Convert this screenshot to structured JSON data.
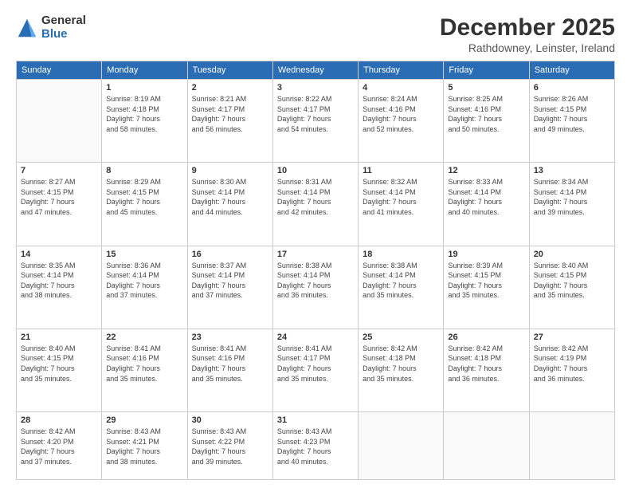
{
  "logo": {
    "general": "General",
    "blue": "Blue"
  },
  "title": "December 2025",
  "location": "Rathdowney, Leinster, Ireland",
  "days_of_week": [
    "Sunday",
    "Monday",
    "Tuesday",
    "Wednesday",
    "Thursday",
    "Friday",
    "Saturday"
  ],
  "weeks": [
    [
      {
        "day": "",
        "info": ""
      },
      {
        "day": "1",
        "info": "Sunrise: 8:19 AM\nSunset: 4:18 PM\nDaylight: 7 hours\nand 58 minutes."
      },
      {
        "day": "2",
        "info": "Sunrise: 8:21 AM\nSunset: 4:17 PM\nDaylight: 7 hours\nand 56 minutes."
      },
      {
        "day": "3",
        "info": "Sunrise: 8:22 AM\nSunset: 4:17 PM\nDaylight: 7 hours\nand 54 minutes."
      },
      {
        "day": "4",
        "info": "Sunrise: 8:24 AM\nSunset: 4:16 PM\nDaylight: 7 hours\nand 52 minutes."
      },
      {
        "day": "5",
        "info": "Sunrise: 8:25 AM\nSunset: 4:16 PM\nDaylight: 7 hours\nand 50 minutes."
      },
      {
        "day": "6",
        "info": "Sunrise: 8:26 AM\nSunset: 4:15 PM\nDaylight: 7 hours\nand 49 minutes."
      }
    ],
    [
      {
        "day": "7",
        "info": "Sunrise: 8:27 AM\nSunset: 4:15 PM\nDaylight: 7 hours\nand 47 minutes."
      },
      {
        "day": "8",
        "info": "Sunrise: 8:29 AM\nSunset: 4:15 PM\nDaylight: 7 hours\nand 45 minutes."
      },
      {
        "day": "9",
        "info": "Sunrise: 8:30 AM\nSunset: 4:14 PM\nDaylight: 7 hours\nand 44 minutes."
      },
      {
        "day": "10",
        "info": "Sunrise: 8:31 AM\nSunset: 4:14 PM\nDaylight: 7 hours\nand 42 minutes."
      },
      {
        "day": "11",
        "info": "Sunrise: 8:32 AM\nSunset: 4:14 PM\nDaylight: 7 hours\nand 41 minutes."
      },
      {
        "day": "12",
        "info": "Sunrise: 8:33 AM\nSunset: 4:14 PM\nDaylight: 7 hours\nand 40 minutes."
      },
      {
        "day": "13",
        "info": "Sunrise: 8:34 AM\nSunset: 4:14 PM\nDaylight: 7 hours\nand 39 minutes."
      }
    ],
    [
      {
        "day": "14",
        "info": "Sunrise: 8:35 AM\nSunset: 4:14 PM\nDaylight: 7 hours\nand 38 minutes."
      },
      {
        "day": "15",
        "info": "Sunrise: 8:36 AM\nSunset: 4:14 PM\nDaylight: 7 hours\nand 37 minutes."
      },
      {
        "day": "16",
        "info": "Sunrise: 8:37 AM\nSunset: 4:14 PM\nDaylight: 7 hours\nand 37 minutes."
      },
      {
        "day": "17",
        "info": "Sunrise: 8:38 AM\nSunset: 4:14 PM\nDaylight: 7 hours\nand 36 minutes."
      },
      {
        "day": "18",
        "info": "Sunrise: 8:38 AM\nSunset: 4:14 PM\nDaylight: 7 hours\nand 35 minutes."
      },
      {
        "day": "19",
        "info": "Sunrise: 8:39 AM\nSunset: 4:15 PM\nDaylight: 7 hours\nand 35 minutes."
      },
      {
        "day": "20",
        "info": "Sunrise: 8:40 AM\nSunset: 4:15 PM\nDaylight: 7 hours\nand 35 minutes."
      }
    ],
    [
      {
        "day": "21",
        "info": "Sunrise: 8:40 AM\nSunset: 4:15 PM\nDaylight: 7 hours\nand 35 minutes."
      },
      {
        "day": "22",
        "info": "Sunrise: 8:41 AM\nSunset: 4:16 PM\nDaylight: 7 hours\nand 35 minutes."
      },
      {
        "day": "23",
        "info": "Sunrise: 8:41 AM\nSunset: 4:16 PM\nDaylight: 7 hours\nand 35 minutes."
      },
      {
        "day": "24",
        "info": "Sunrise: 8:41 AM\nSunset: 4:17 PM\nDaylight: 7 hours\nand 35 minutes."
      },
      {
        "day": "25",
        "info": "Sunrise: 8:42 AM\nSunset: 4:18 PM\nDaylight: 7 hours\nand 35 minutes."
      },
      {
        "day": "26",
        "info": "Sunrise: 8:42 AM\nSunset: 4:18 PM\nDaylight: 7 hours\nand 36 minutes."
      },
      {
        "day": "27",
        "info": "Sunrise: 8:42 AM\nSunset: 4:19 PM\nDaylight: 7 hours\nand 36 minutes."
      }
    ],
    [
      {
        "day": "28",
        "info": "Sunrise: 8:42 AM\nSunset: 4:20 PM\nDaylight: 7 hours\nand 37 minutes."
      },
      {
        "day": "29",
        "info": "Sunrise: 8:43 AM\nSunset: 4:21 PM\nDaylight: 7 hours\nand 38 minutes."
      },
      {
        "day": "30",
        "info": "Sunrise: 8:43 AM\nSunset: 4:22 PM\nDaylight: 7 hours\nand 39 minutes."
      },
      {
        "day": "31",
        "info": "Sunrise: 8:43 AM\nSunset: 4:23 PM\nDaylight: 7 hours\nand 40 minutes."
      },
      {
        "day": "",
        "info": ""
      },
      {
        "day": "",
        "info": ""
      },
      {
        "day": "",
        "info": ""
      }
    ]
  ]
}
